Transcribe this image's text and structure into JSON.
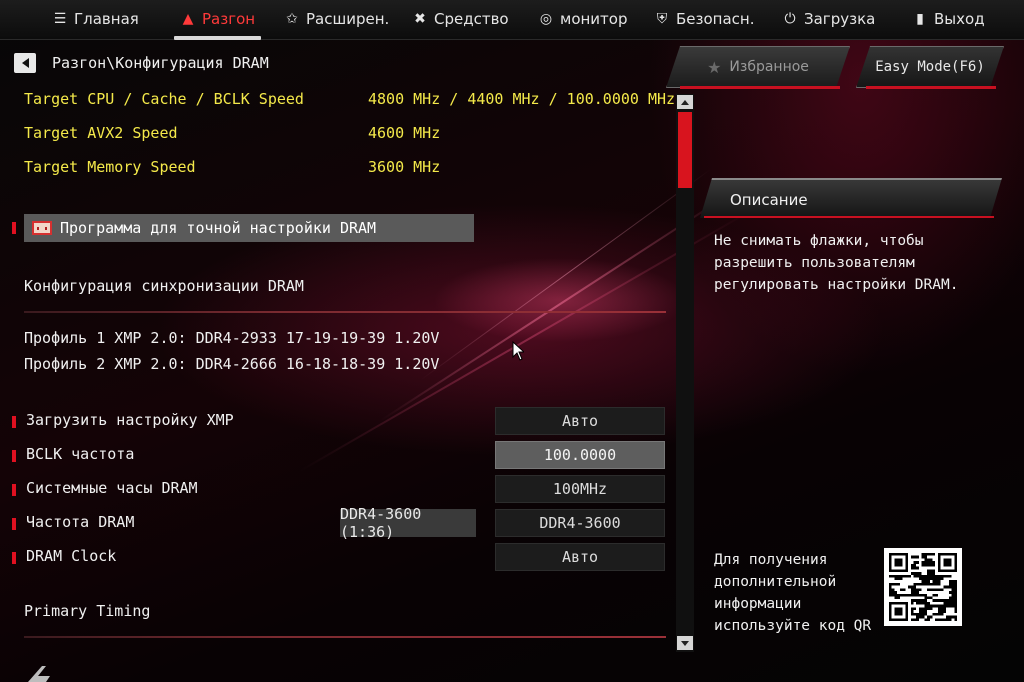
{
  "nav": {
    "tabs": [
      {
        "label": "Главная",
        "icon": "list-icon"
      },
      {
        "label": "Разгон",
        "icon": "flame-icon"
      },
      {
        "label": "Расширен.",
        "icon": "star-icon"
      },
      {
        "label": "Средство",
        "icon": "tools-icon"
      },
      {
        "label": "монитор",
        "icon": "gauge-icon"
      },
      {
        "label": "Безопасн.",
        "icon": "shield-icon"
      },
      {
        "label": "Загрузка",
        "icon": "power-icon"
      },
      {
        "label": "Выход",
        "icon": "exit-door-icon"
      }
    ],
    "active_tab": "Разгон",
    "accent_color": "#ff3a3a"
  },
  "breadcrumb": "Разгон\\Конфигурация DRAM",
  "targets": [
    {
      "label": "Target CPU / Cache / BCLK Speed",
      "value": "4800 MHz / 4400 MHz / 100.0000 MHz"
    },
    {
      "label": "Target AVX2 Speed",
      "value": "4600 MHz"
    },
    {
      "label": "Target Memory Speed",
      "value": "3600 MHz"
    }
  ],
  "tuner_label": "Программа для точной настройки DRAM",
  "sync_section": "Конфигурация синхронизации DRAM",
  "profiles": [
    "Профиль 1 XMP 2.0: DDR4-2933 17-19-19-39 1.20V",
    "Профиль 2 XMP 2.0: DDR4-2666 16-18-18-39 1.20V"
  ],
  "settings": [
    {
      "label": "Загрузить настройку XMP",
      "value": "Авто"
    },
    {
      "label": "BCLK частота",
      "value": "100.0000"
    },
    {
      "label": "Системные часы DRAM",
      "value": "100MHz"
    },
    {
      "label": "Частота DRAM",
      "value": "DDR4-3600",
      "ratio": "DDR4-3600 (1:36)"
    },
    {
      "label": "DRAM Clock",
      "value": "Авто"
    }
  ],
  "primary_timing": "Primary Timing",
  "favorites_label": "Избранное",
  "easy_mode_label": "Easy Mode(F6)",
  "description": {
    "title": "Описание",
    "text": "Не снимать флажки, чтобы разрешить пользователям регулировать настройки DRAM."
  },
  "qr_text": "Для получения дополнительной информации используйте код QR",
  "colors": {
    "highlight_yellow": "#f4e94a",
    "accent_red": "#d8141e"
  }
}
